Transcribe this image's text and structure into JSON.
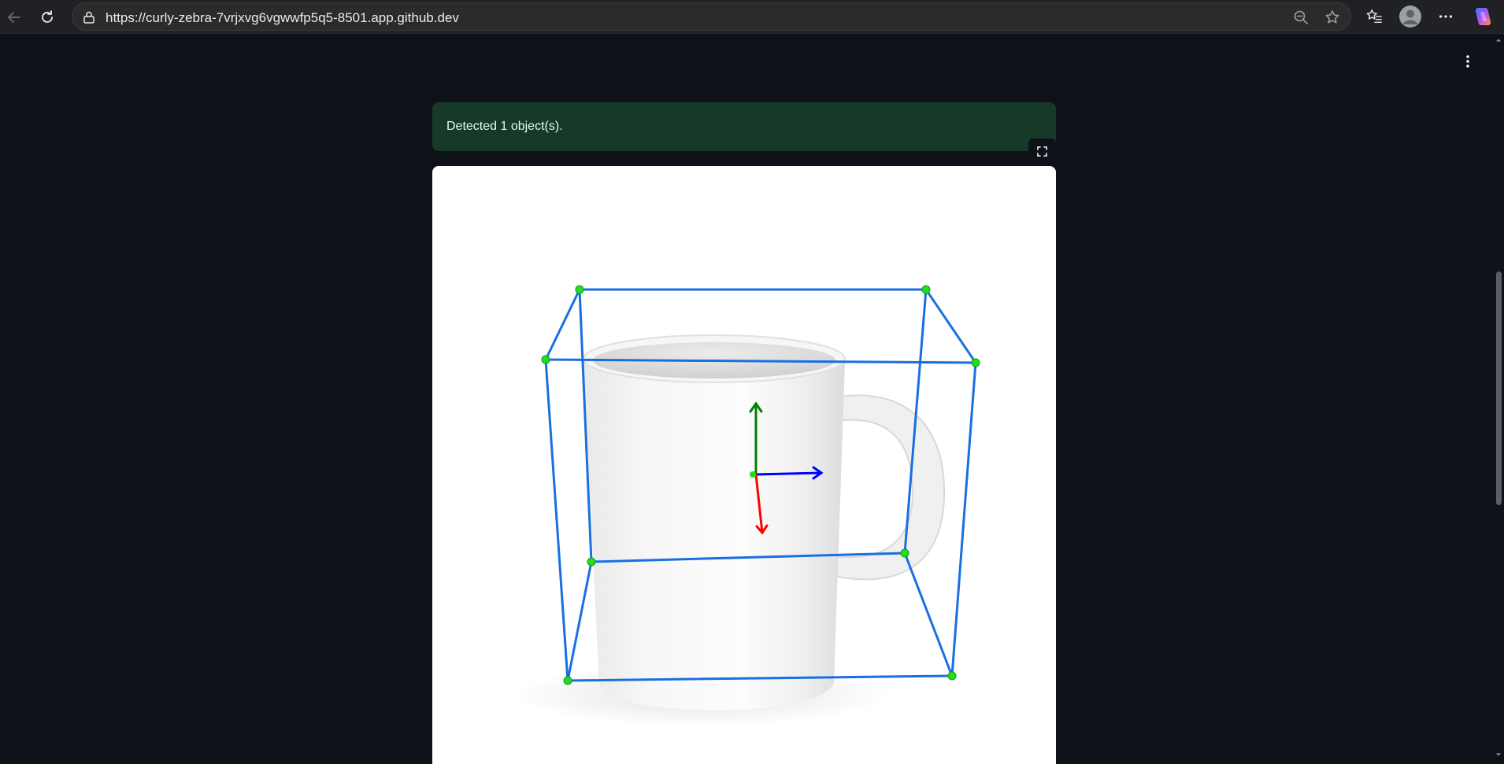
{
  "browser": {
    "url": "https://curly-zebra-7vrjxvg6vgwwfp5q5-8501.app.github.dev",
    "icons": {
      "back": "arrow-left-icon",
      "reload": "reload-icon",
      "lock": "site-info-icon",
      "zoom": "zoom-out-icon",
      "favorite": "star-icon",
      "favorites_list": "favorites-icon",
      "profile": "profile-avatar-icon",
      "more": "more-horizontal-icon",
      "copilot": "copilot-icon"
    }
  },
  "app": {
    "menu_icon": "kebab-menu-icon",
    "alert": {
      "text": "Detected 1 object(s).",
      "background": "#173928",
      "text_color": "#dffde9"
    },
    "fullscreen_icon": "fullscreen-icon",
    "result_image": {
      "subject": "white coffee mug",
      "box_color": "#1a6fe0",
      "keypoint_color": "#22dd22",
      "axes": [
        {
          "name": "x-axis",
          "color": "#0000ff"
        },
        {
          "name": "y-axis",
          "color": "#008000"
        },
        {
          "name": "z-axis",
          "color": "#ff0000"
        }
      ]
    }
  },
  "colors": {
    "page_background": "#0e1117",
    "browser_bar": "#202124"
  }
}
